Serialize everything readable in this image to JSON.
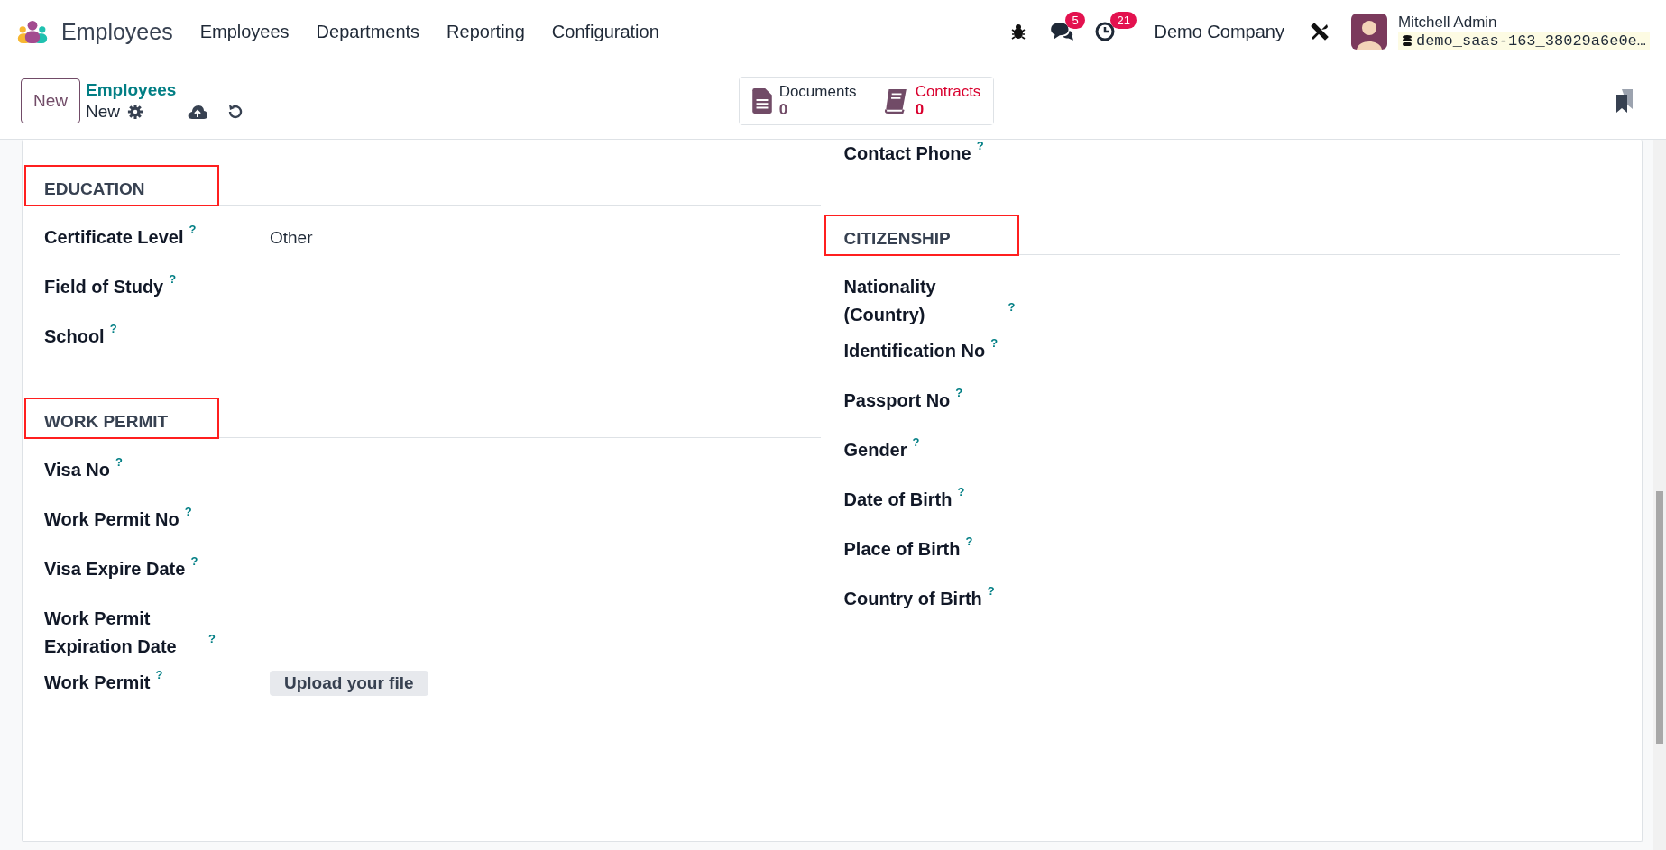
{
  "navbar": {
    "app_name": "Employees",
    "menu": [
      "Employees",
      "Departments",
      "Reporting",
      "Configuration"
    ],
    "messages_count": "5",
    "activities_count": "21",
    "company": "Demo Company",
    "user": "Mitchell Admin",
    "database": "demo_saas-163_38029a6e0e…"
  },
  "control_panel": {
    "new_button": "New",
    "breadcrumb": "Employees",
    "record": "New",
    "smart_buttons": [
      {
        "kind": "documents",
        "label": "Documents",
        "value": "0",
        "warning": false
      },
      {
        "kind": "contracts",
        "label": "Contracts",
        "value": "0",
        "warning": true
      }
    ]
  },
  "form": {
    "columns": [
      [
        {
          "kind": "section",
          "title": "EDUCATION",
          "highlighted": true
        },
        {
          "kind": "field",
          "label": "Certificate Level",
          "help": "?",
          "value": "Other"
        },
        {
          "kind": "field",
          "label": "Field of Study",
          "help": "?"
        },
        {
          "kind": "field",
          "label": "School",
          "help": "?"
        },
        {
          "kind": "section",
          "title": "WORK PERMIT",
          "highlighted": true
        },
        {
          "kind": "field",
          "label": "Visa No",
          "help": "?"
        },
        {
          "kind": "field",
          "label": "Work Permit No",
          "help": "?"
        },
        {
          "kind": "field",
          "label": "Visa Expire Date",
          "help": "?"
        },
        {
          "kind": "field",
          "label": "Work Permit Expiration Date",
          "help": "?"
        },
        {
          "kind": "upload",
          "label": "Work Permit",
          "help": "?",
          "button": "Upload your file"
        }
      ],
      [
        {
          "kind": "field",
          "label": "Contact Phone",
          "help": "?"
        },
        {
          "kind": "section",
          "title": "CITIZENSHIP",
          "highlighted": true
        },
        {
          "kind": "field",
          "label": "Nationality (Country)",
          "help": "?"
        },
        {
          "kind": "field",
          "label": "Identification No",
          "help": "?"
        },
        {
          "kind": "field",
          "label": "Passport No",
          "help": "?"
        },
        {
          "kind": "field",
          "label": "Gender",
          "help": "?"
        },
        {
          "kind": "field",
          "label": "Date of Birth",
          "help": "?"
        },
        {
          "kind": "field",
          "label": "Place of Birth",
          "help": "?"
        },
        {
          "kind": "field",
          "label": "Country of Birth",
          "help": "?"
        }
      ]
    ]
  }
}
